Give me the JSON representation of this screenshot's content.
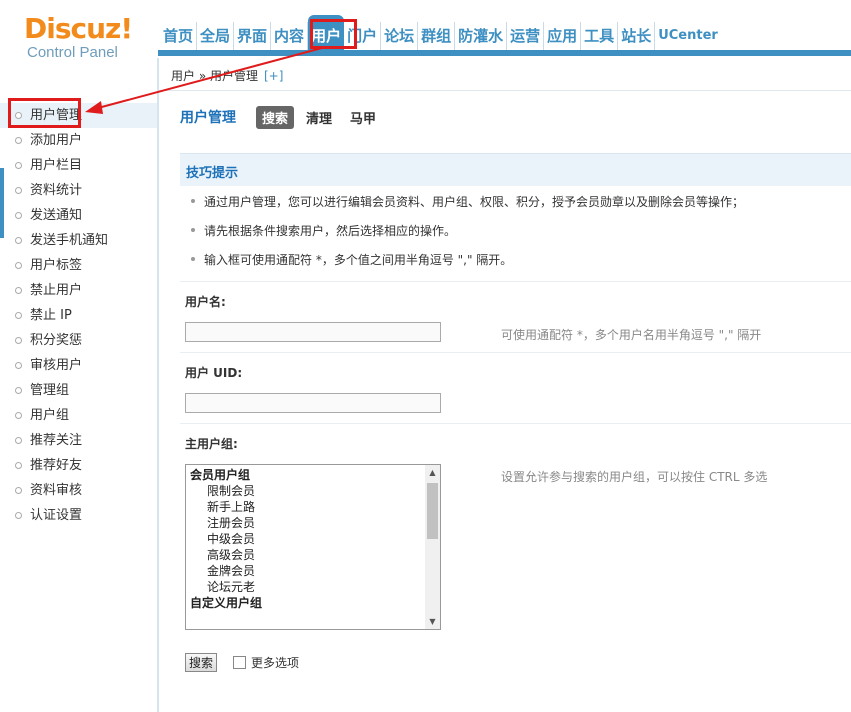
{
  "header": {
    "logo_main": "Discuz!",
    "logo_sub": "Control Panel",
    "nav": [
      {
        "label": "首页",
        "active": false
      },
      {
        "label": "全局",
        "active": false
      },
      {
        "label": "界面",
        "active": false
      },
      {
        "label": "内容",
        "active": false
      },
      {
        "label": "用户",
        "active": true
      },
      {
        "label": "门户",
        "active": false
      },
      {
        "label": "论坛",
        "active": false
      },
      {
        "label": "群组",
        "active": false
      },
      {
        "label": "防灌水",
        "active": false
      },
      {
        "label": "运营",
        "active": false
      },
      {
        "label": "应用",
        "active": false
      },
      {
        "label": "工具",
        "active": false
      },
      {
        "label": "站长",
        "active": false
      },
      {
        "label": "UCenter",
        "active": false
      }
    ]
  },
  "breadcrumb": {
    "text": "用户 » 用户管理",
    "add": "[+]"
  },
  "sidebar": {
    "items": [
      {
        "label": "用户管理",
        "active": true
      },
      {
        "label": "添加用户"
      },
      {
        "label": "用户栏目"
      },
      {
        "label": "资料统计"
      },
      {
        "label": "发送通知"
      },
      {
        "label": "发送手机通知"
      },
      {
        "label": "用户标签"
      },
      {
        "label": "禁止用户"
      },
      {
        "label": "禁止 IP"
      },
      {
        "label": "积分奖惩"
      },
      {
        "label": "审核用户"
      },
      {
        "label": "管理组"
      },
      {
        "label": "用户组"
      },
      {
        "label": "推荐关注"
      },
      {
        "label": "推荐好友"
      },
      {
        "label": "资料审核"
      },
      {
        "label": "认证设置"
      }
    ]
  },
  "main": {
    "title": "用户管理",
    "tabs": [
      {
        "label": "搜索",
        "active": true
      },
      {
        "label": "清理"
      },
      {
        "label": "马甲"
      }
    ],
    "tips_title": "技巧提示",
    "tips": [
      "通过用户管理，您可以进行编辑会员资料、用户组、权限、积分，授予会员勋章以及删除会员等操作；",
      "请先根据条件搜索用户，然后选择相应的操作。",
      "输入框可使用通配符 *，多个值之间用半角逗号 \",\" 隔开。"
    ],
    "username": {
      "label": "用户名:",
      "value": "",
      "hint": "可使用通配符 *，多个用户名用半角逗号 \",\" 隔开"
    },
    "uid": {
      "label": "用户 UID:",
      "value": ""
    },
    "group": {
      "label": "主用户组:",
      "hint": "设置允许参与搜索的用户组，可以按住 CTRL 多选",
      "options": [
        {
          "label": "会员用户组",
          "type": "head"
        },
        {
          "label": "限制会员",
          "type": "child"
        },
        {
          "label": "新手上路",
          "type": "child"
        },
        {
          "label": "注册会员",
          "type": "child"
        },
        {
          "label": "中级会员",
          "type": "child"
        },
        {
          "label": "高级会员",
          "type": "child"
        },
        {
          "label": "金牌会员",
          "type": "child"
        },
        {
          "label": "论坛元老",
          "type": "child"
        },
        {
          "label": "自定义用户组",
          "type": "head"
        }
      ]
    },
    "search_button": "搜索",
    "more_options": "更多选项"
  },
  "colors": {
    "accent": "#3e8fc2",
    "logo": "#f38b1c",
    "annotation": "#e01b1b"
  }
}
